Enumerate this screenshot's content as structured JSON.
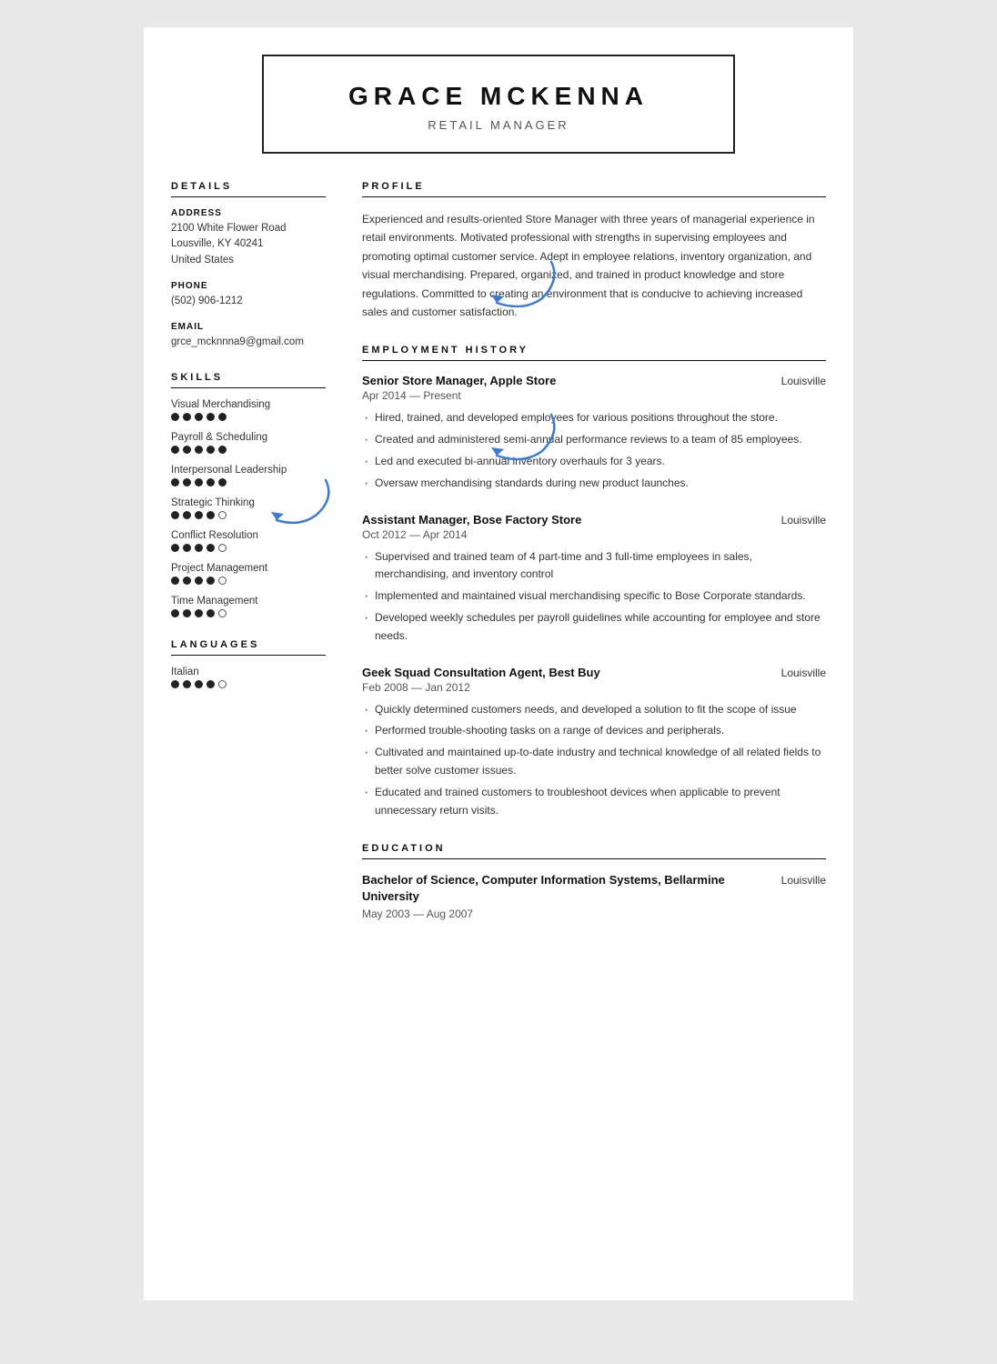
{
  "header": {
    "name": "GRACE MCKENNA",
    "title": "RETAIL MANAGER"
  },
  "sidebar": {
    "details_label": "DETAILS",
    "address_label": "ADDRESS",
    "address_line1": "2100 White Flower Road",
    "address_line2": "Lousville, KY 40241",
    "address_line3": "United States",
    "phone_label": "PHONE",
    "phone": "(502) 906-1212",
    "email_label": "EMAIL",
    "email": "grce_mcknnna9@gmail.com",
    "skills_label": "SKILLS",
    "skills": [
      {
        "name": "Visual Merchandising",
        "filled": 5,
        "empty": 0
      },
      {
        "name": "Payroll & Scheduling",
        "filled": 5,
        "empty": 0
      },
      {
        "name": "Interpersonal Leadership",
        "filled": 5,
        "empty": 0
      },
      {
        "name": "Strategic Thinking",
        "filled": 4,
        "empty": 1
      },
      {
        "name": "Conflict Resolution",
        "filled": 4,
        "empty": 1
      },
      {
        "name": "Project Management",
        "filled": 4,
        "empty": 1
      },
      {
        "name": "Time Management",
        "filled": 4,
        "empty": 1
      }
    ],
    "languages_label": "LANGUAGES",
    "languages": [
      {
        "name": "Italian",
        "filled": 4,
        "empty": 1
      }
    ]
  },
  "main": {
    "profile_label": "PROFILE",
    "profile_text": "Experienced and results-oriented Store Manager with three years of managerial experience in retail environments. Motivated professional with strengths in supervising employees and promoting optimal customer service. Adept in employee relations, inventory organization, and visual merchandising. Prepared, organized, and trained in product knowledge and store regulations. Committed to creating an environment that is conducive to achieving increased sales and customer satisfaction.",
    "employment_label": "EMPLOYMENT HISTORY",
    "jobs": [
      {
        "title": "Senior Store Manager, Apple Store",
        "location": "Louisville",
        "dates": "Apr 2014 — Present",
        "bullets": [
          "Hired, trained, and developed employees for various positions throughout the store.",
          "Created and administered semi-annual performance reviews to a team of 85 employees.",
          "Led and executed bi-annual inventory overhauls for 3 years.",
          "Oversaw merchandising standards during new product launches."
        ]
      },
      {
        "title": "Assistant Manager, Bose Factory Store",
        "location": "Louisville",
        "dates": "Oct 2012 — Apr 2014",
        "bullets": [
          "Supervised and trained team of 4 part-time and 3 full-time employees in sales, merchandising, and inventory control",
          "Implemented and maintained visual merchandising specific to Bose Corporate standards.",
          "Developed weekly schedules per payroll guidelines while accounting for employee and store needs."
        ]
      },
      {
        "title": "Geek Squad Consultation Agent, Best Buy",
        "location": "Louisville",
        "dates": "Feb 2008 — Jan 2012",
        "bullets": [
          "Quickly determined customers needs, and developed a solution to fit the scope of issue",
          "Performed trouble-shooting tasks on a range of devices and peripherals.",
          "Cultivated and maintained up-to-date industry and technical knowledge of all related fields to better solve customer issues.",
          "Educated and trained customers to troubleshoot devices when applicable to prevent unnecessary return visits."
        ]
      }
    ],
    "education_label": "EDUCATION",
    "education": [
      {
        "title": "Bachelor of Science, Computer Information Systems, Bellarmine University",
        "location": "Louisville",
        "dates": "May 2003 — Aug 2007"
      }
    ]
  }
}
